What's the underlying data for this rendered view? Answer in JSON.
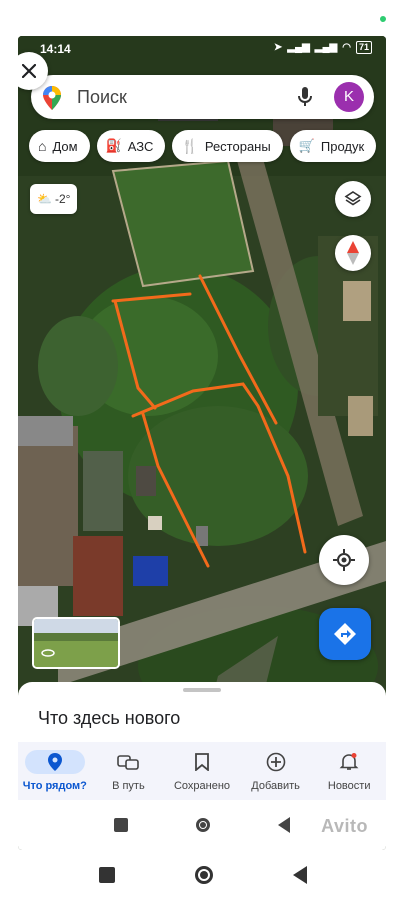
{
  "status_bar": {
    "time": "14:14",
    "battery": "71"
  },
  "search": {
    "placeholder": "Поиск",
    "avatar_letter": "K"
  },
  "chips": [
    {
      "label": "Дом",
      "icon": "home-icon"
    },
    {
      "label": "АЗС",
      "icon": "gas-station-icon"
    },
    {
      "label": "Рестораны",
      "icon": "restaurant-icon"
    },
    {
      "label": "Продук",
      "icon": "cart-icon"
    }
  ],
  "weather": {
    "temp": "-2°",
    "icon": "partly-cloudy-icon"
  },
  "sheet": {
    "title": "Что здесь нового"
  },
  "nav": [
    {
      "label": "Что рядом?",
      "icon": "location-pin-icon",
      "active": true
    },
    {
      "label": "В путь",
      "icon": "commute-icon",
      "active": false
    },
    {
      "label": "Сохранено",
      "icon": "bookmark-icon",
      "active": false
    },
    {
      "label": "Добавить",
      "icon": "add-circle-icon",
      "active": false
    },
    {
      "label": "Новости",
      "icon": "bell-icon",
      "active": false
    }
  ],
  "watermark": "Avito",
  "colors": {
    "accent": "#1a73e8",
    "active_nav": "#0b57d0",
    "annotation": "#f26a1b",
    "avatar": "#9b2fae"
  }
}
